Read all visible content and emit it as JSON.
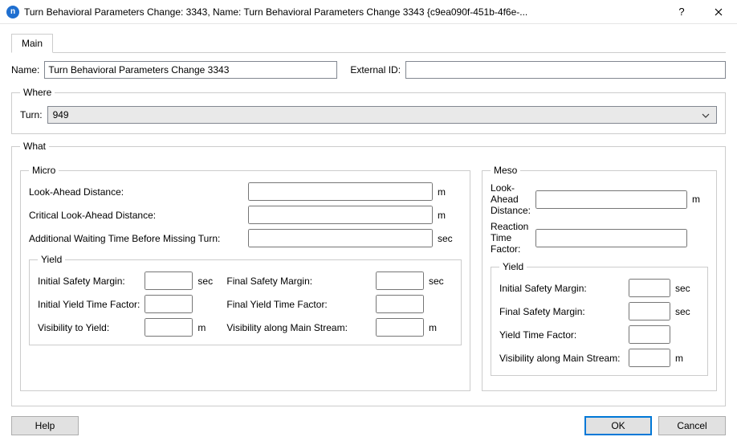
{
  "window": {
    "title": "Turn Behavioral Parameters Change: 3343, Name: Turn Behavioral Parameters Change 3343  {c9ea090f-451b-4f6e-..."
  },
  "tabs": {
    "main": "Main"
  },
  "nameRow": {
    "label": "Name:",
    "value": "Turn Behavioral Parameters Change 3343",
    "externalIdLabel": "External ID:",
    "externalIdValue": ""
  },
  "where": {
    "legend": "Where",
    "turnLabel": "Turn:",
    "turnValue": "949"
  },
  "what": {
    "legend": "What",
    "micro": {
      "legend": "Micro",
      "lookAheadLabel": "Look-Ahead Distance:",
      "lookAheadValue": "",
      "lookAheadUnit": "m",
      "critLookAheadLabel": "Critical Look-Ahead Distance:",
      "critLookAheadValue": "",
      "critLookAheadUnit": "m",
      "addWaitLabel": "Additional Waiting Time Before Missing Turn:",
      "addWaitValue": "",
      "addWaitUnit": "sec",
      "yieldLegend": "Yield",
      "initSafetyLabel": "Initial Safety Margin:",
      "initSafetyValue": "",
      "initSafetyUnit": "sec",
      "finalSafetyLabel": "Final Safety Margin:",
      "finalSafetyValue": "",
      "finalSafetyUnit": "sec",
      "initYieldFactorLabel": "Initial Yield Time Factor:",
      "initYieldFactorValue": "",
      "finalYieldFactorLabel": "Final Yield Time Factor:",
      "finalYieldFactorValue": "",
      "visToYieldLabel": "Visibility to Yield:",
      "visToYieldValue": "",
      "visToYieldUnit": "m",
      "visMainLabel": "Visibility along Main Stream:",
      "visMainValue": "",
      "visMainUnit": "m"
    },
    "meso": {
      "legend": "Meso",
      "lookAheadLabel": "Look-Ahead Distance:",
      "lookAheadValue": "",
      "lookAheadUnit": "m",
      "reactionLabel": "Reaction Time Factor:",
      "reactionValue": "",
      "yieldLegend": "Yield",
      "initSafetyLabel": "Initial Safety Margin:",
      "initSafetyValue": "",
      "initSafetyUnit": "sec",
      "finalSafetyLabel": "Final Safety Margin:",
      "finalSafetyValue": "",
      "finalSafetyUnit": "sec",
      "yieldFactorLabel": "Yield Time Factor:",
      "yieldFactorValue": "",
      "visMainLabel": "Visibility along Main Stream:",
      "visMainValue": "",
      "visMainUnit": "m"
    }
  },
  "footer": {
    "help": "Help",
    "ok": "OK",
    "cancel": "Cancel"
  }
}
